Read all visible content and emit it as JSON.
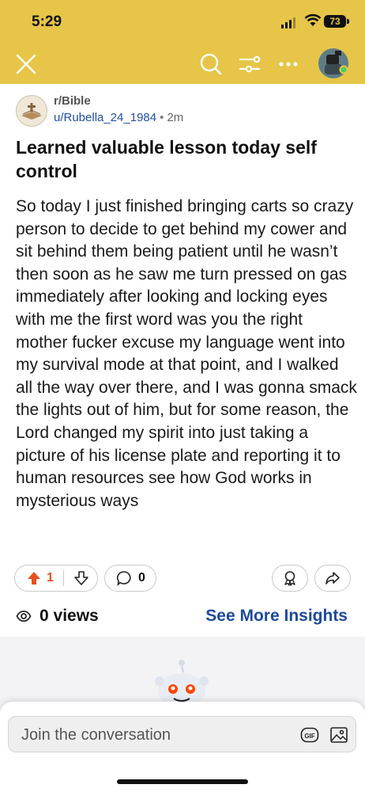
{
  "status_bar": {
    "time": "5:29",
    "battery": "73"
  },
  "post": {
    "subreddit": "r/Bible",
    "author": "u/Rubella_24_1984",
    "separator": "•",
    "age": "2m",
    "title": "Learned valuable lesson today self control",
    "body": "So today I just finished bringing carts so crazy person to decide to get behind my cower and sit behind them being patient until he wasn’t then soon as he saw me turn pressed on gas immediately after looking and locking eyes with me the first word was you the right mother fucker excuse my language went into my survival mode at that point, and I walked all the way over there, and I was gonna smack the lights out of him, but for some reason, the Lord changed my spirit into just taking a picture of his license plate and reporting it to human resources see how God works in mysterious ways"
  },
  "actions": {
    "upvotes": "1",
    "comments": "0"
  },
  "insights": {
    "views": "0 views",
    "see_more": "See More Insights"
  },
  "composer": {
    "placeholder": "Join the conversation",
    "gif_label": "GIF"
  },
  "colors": {
    "header": "#e6c548",
    "upvote": "#e8501e",
    "link_blue": "#1d4a9b"
  }
}
